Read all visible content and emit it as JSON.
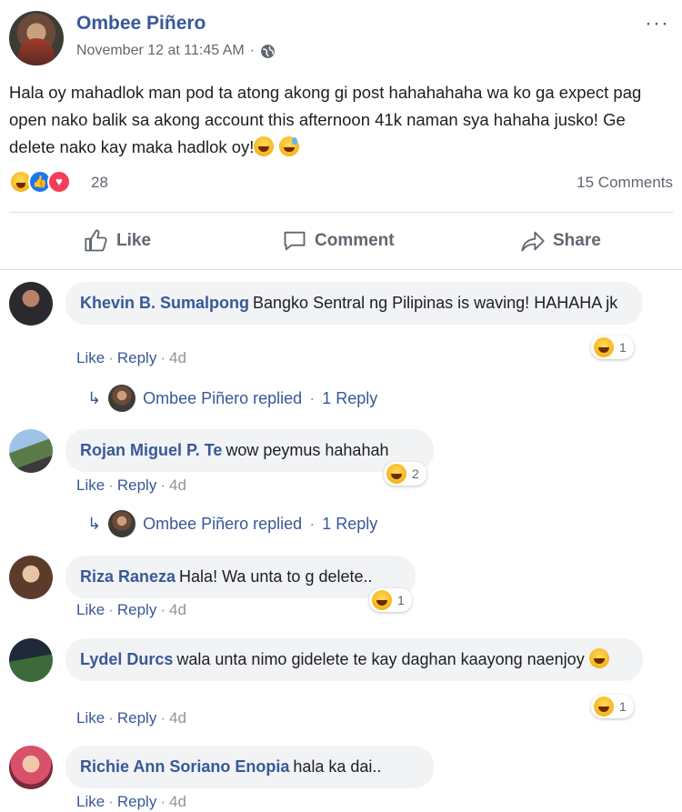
{
  "post": {
    "author": "Ombee Piñero",
    "timestamp": "November 12 at 11:45 AM",
    "meta_sep": "·",
    "more": "···",
    "text": "Hala oy mahadlok man pod ta atong akong gi post hahahahaha wa ko ga expect pag open nako balik sa akong account this afternoon 41k naman sya hahaha jusko! Ge delete nako kay maka hadlok oy!",
    "reaction_count": "28",
    "comments_count": "15 Comments"
  },
  "actions": {
    "like": "Like",
    "comment": "Comment",
    "share": "Share"
  },
  "comments": [
    {
      "author": "Khevin B. Sumalpong",
      "text": "Bangko Sentral ng Pilipinas is waving! HAHAHA jk",
      "like": "Like",
      "reply": "Reply",
      "time": "4d",
      "reactions": "1",
      "reply_summary": {
        "name": "Ombee Piñero replied",
        "count": "1 Reply"
      }
    },
    {
      "author": "Rojan Miguel P. Te",
      "text": "wow peymus hahahah",
      "like": "Like",
      "reply": "Reply",
      "time": "4d",
      "reactions": "2",
      "reply_summary": {
        "name": "Ombee Piñero replied",
        "count": "1 Reply"
      }
    },
    {
      "author": "Riza Raneza",
      "text": "Hala! Wa unta to g delete..",
      "like": "Like",
      "reply": "Reply",
      "time": "4d",
      "reactions": "1"
    },
    {
      "author": "Lydel Durcs",
      "text": "wala unta nimo gidelete te kay daghan kaayong naenjoy",
      "like": "Like",
      "reply": "Reply",
      "time": "4d",
      "reactions": "1"
    },
    {
      "author": "Richie Ann Soriano Enopia",
      "text": "hala ka dai..",
      "like": "Like",
      "reply": "Reply",
      "time": "4d"
    }
  ],
  "separator": "·",
  "colors": {
    "link": "#385898",
    "muted": "#606770",
    "bubble": "#f2f3f5"
  },
  "icons": {
    "globe": "globe-icon",
    "like": "thumbs-up-icon",
    "comment": "comment-bubble-icon",
    "share": "share-arrow-icon"
  }
}
